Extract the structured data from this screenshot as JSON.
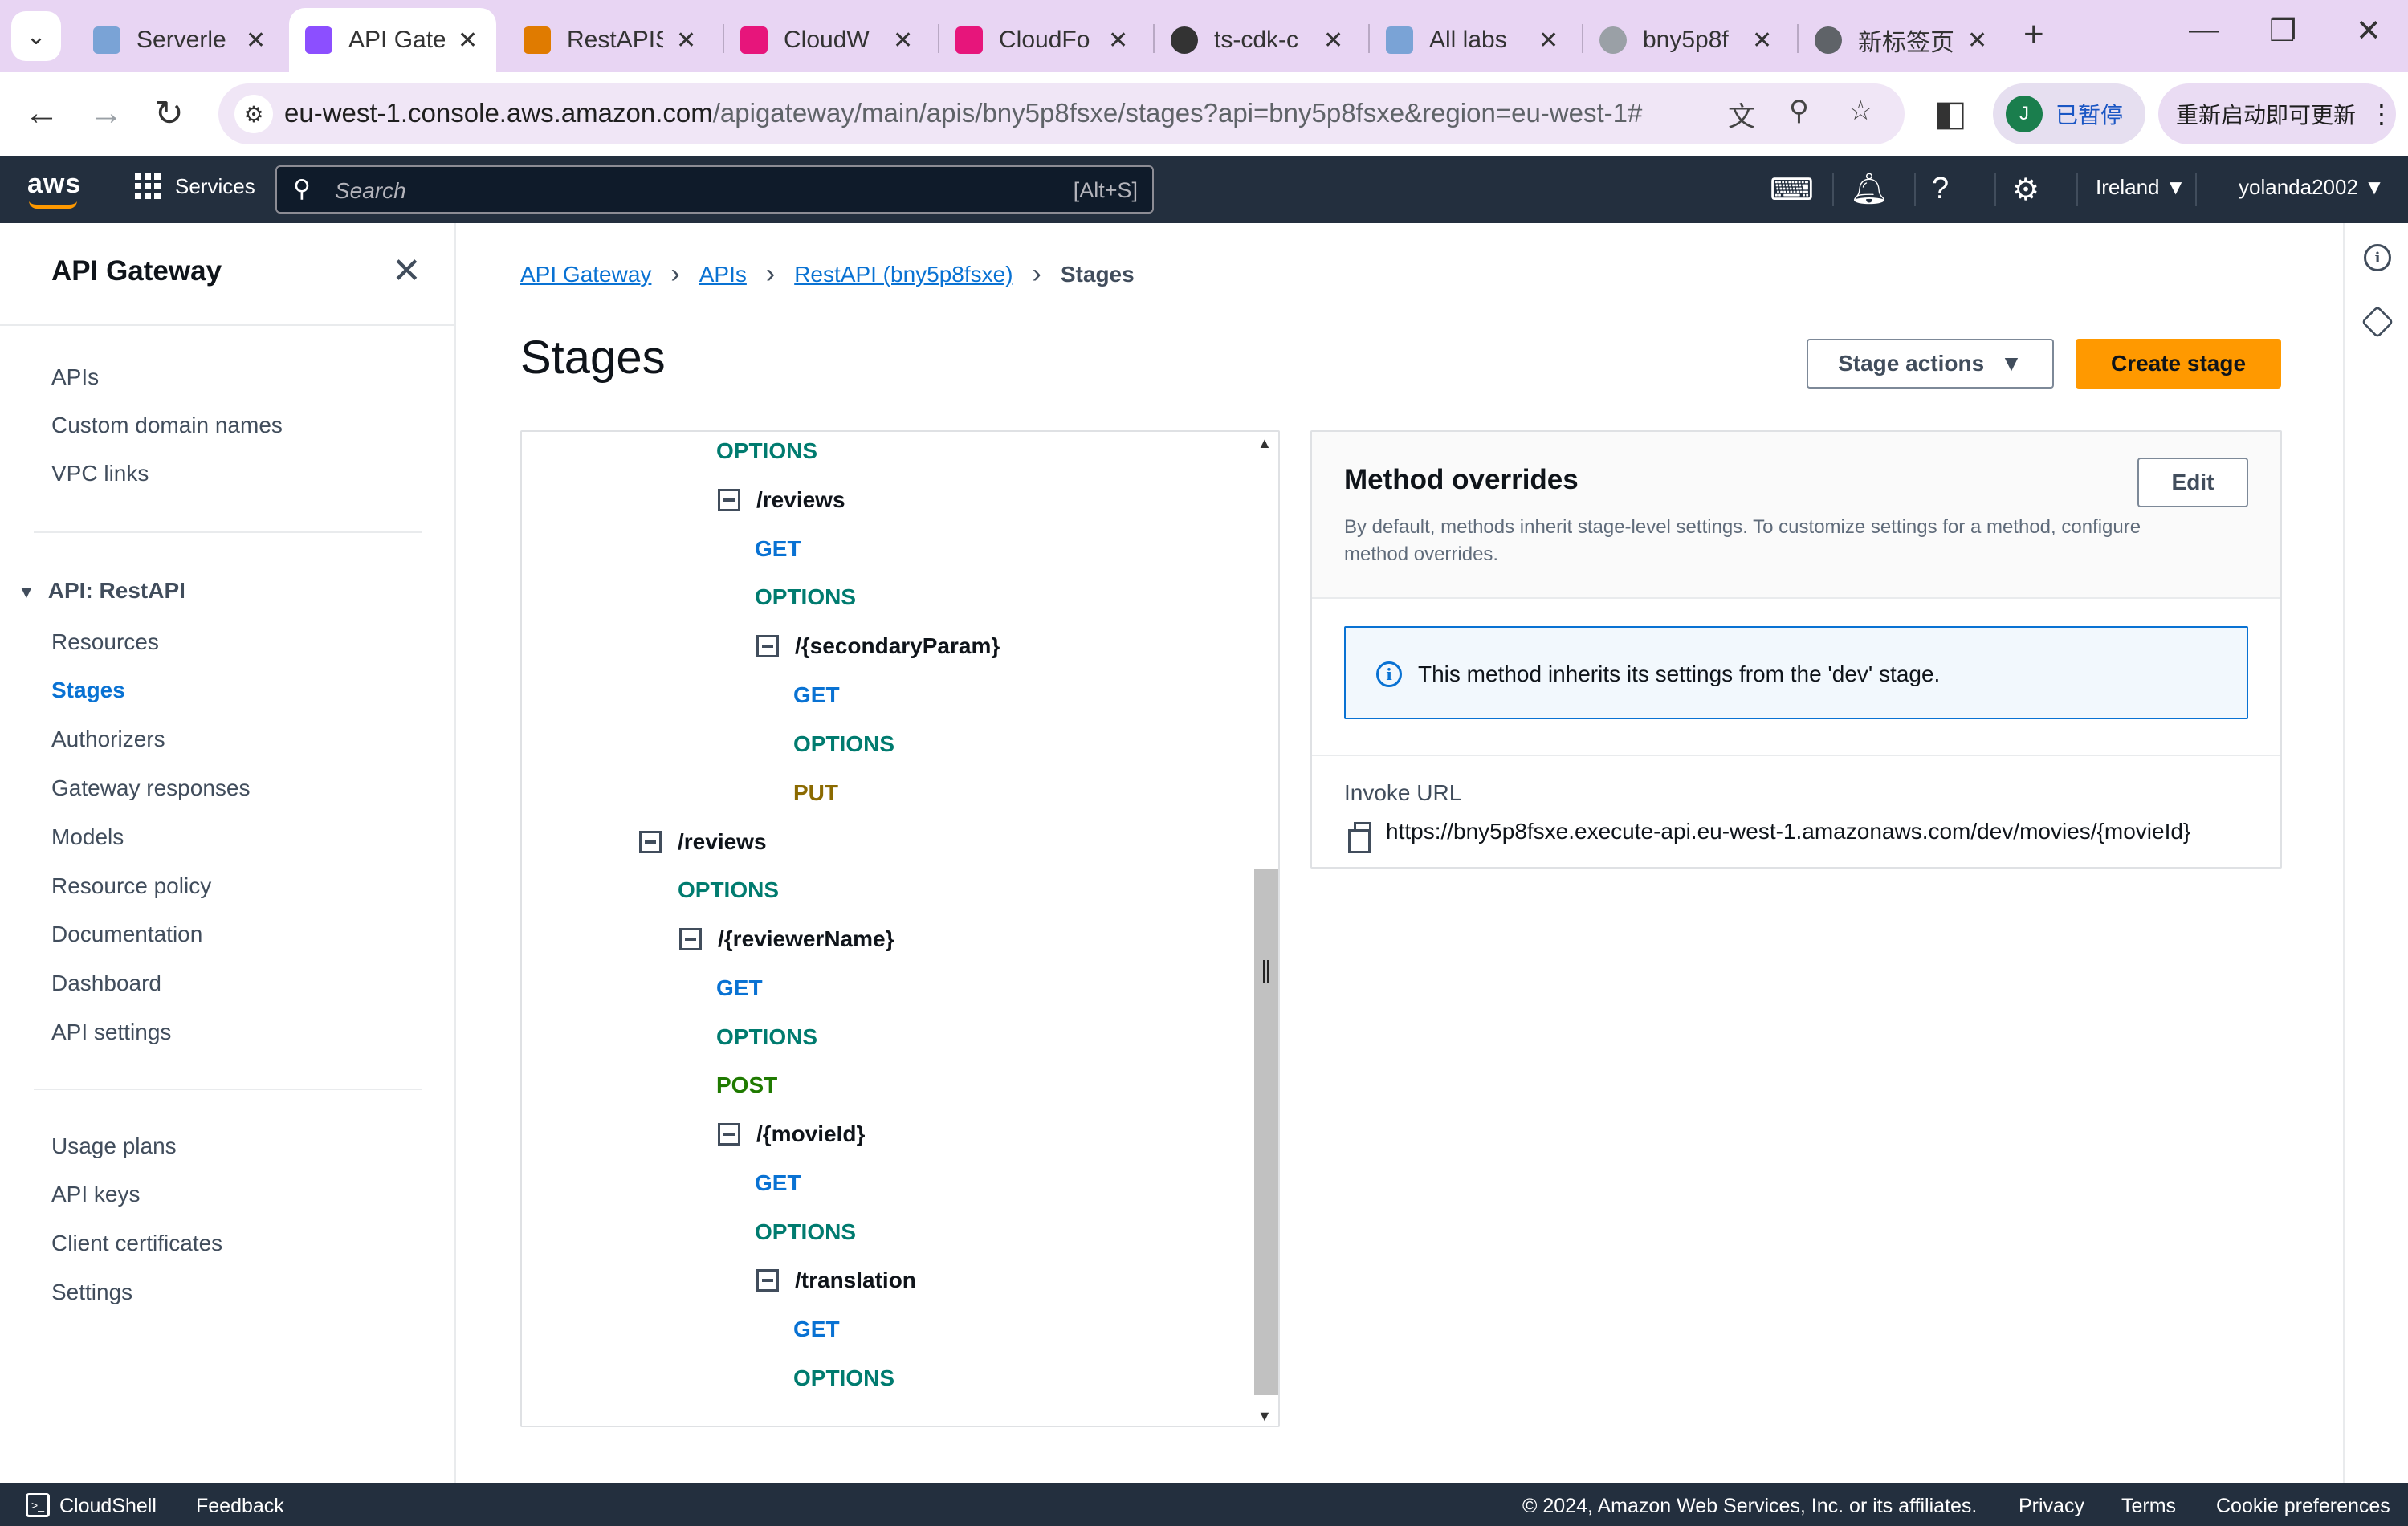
{
  "browser": {
    "tabs": [
      {
        "title": "Serverle",
        "color": "#7aa3d6"
      },
      {
        "title": "API Gate",
        "color": "#8c4fff",
        "active": true
      },
      {
        "title": "RestAPIS",
        "color": "#e07b00"
      },
      {
        "title": "CloudW",
        "color": "#e7157b"
      },
      {
        "title": "CloudFo",
        "color": "#e7157b"
      },
      {
        "title": "ts-cdk-c",
        "color": "#333333"
      },
      {
        "title": "All labs",
        "color": "#7aa3d6"
      },
      {
        "title": "bny5p8f",
        "color": "#9aa0a6"
      },
      {
        "title": "新标签页",
        "color": "#5f6368"
      }
    ],
    "url_host": "eu-west-1.console.aws.amazon.com",
    "url_path": "/apigateway/main/apis/bny5p8fsxe/stages?api=bny5p8fsxe&region=eu-west-1#",
    "profile_initial": "J",
    "profile_status": "已暂停",
    "restart_label": "重新启动即可更新"
  },
  "topnav": {
    "logo": "aws",
    "services_label": "Services",
    "search_placeholder": "Search",
    "search_shortcut": "[Alt+S]",
    "region": "Ireland",
    "user": "yolanda2002"
  },
  "sidenav": {
    "title": "API Gateway",
    "top_items": [
      "APIs",
      "Custom domain names",
      "VPC links"
    ],
    "group_label": "API: RestAPI",
    "group_items": [
      "Resources",
      "Stages",
      "Authorizers",
      "Gateway responses",
      "Models",
      "Resource policy",
      "Documentation",
      "Dashboard",
      "API settings"
    ],
    "active_item": "Stages",
    "bottom_items": [
      "Usage plans",
      "API keys",
      "Client certificates",
      "Settings"
    ]
  },
  "breadcrumb": [
    "API Gateway",
    "APIs",
    "RestAPI (bny5p8fsxe)",
    "Stages"
  ],
  "page_title": "Stages",
  "buttons": {
    "stage_actions": "Stage actions",
    "create_stage": "Create stage",
    "edit": "Edit"
  },
  "tree": [
    {
      "label": "OPTIONS",
      "kind": "method"
    },
    {
      "label": "/reviews",
      "kind": "path"
    },
    {
      "label": "GET",
      "kind": "method"
    },
    {
      "label": "OPTIONS",
      "kind": "method"
    },
    {
      "label": "/{secondaryParam}",
      "kind": "path"
    },
    {
      "label": "GET",
      "kind": "method"
    },
    {
      "label": "OPTIONS",
      "kind": "method"
    },
    {
      "label": "PUT",
      "kind": "method"
    },
    {
      "label": "/reviews",
      "kind": "path"
    },
    {
      "label": "OPTIONS",
      "kind": "method"
    },
    {
      "label": "/{reviewerName}",
      "kind": "path"
    },
    {
      "label": "GET",
      "kind": "method"
    },
    {
      "label": "OPTIONS",
      "kind": "method"
    },
    {
      "label": "POST",
      "kind": "method"
    },
    {
      "label": "/{movieId}",
      "kind": "path"
    },
    {
      "label": "GET",
      "kind": "method"
    },
    {
      "label": "OPTIONS",
      "kind": "method"
    },
    {
      "label": "/translation",
      "kind": "path"
    },
    {
      "label": "GET",
      "kind": "method"
    },
    {
      "label": "OPTIONS",
      "kind": "method"
    }
  ],
  "method_overrides": {
    "title": "Method overrides",
    "description": "By default, methods inherit stage-level settings. To customize settings for a method, configure method overrides.",
    "info": "This method inherits its settings from the 'dev' stage.",
    "invoke_url_label": "Invoke URL",
    "invoke_url": "https://bny5p8fsxe.execute-api.eu-west-1.amazonaws.com/dev/movies/{movieId}"
  },
  "footer": {
    "cloudshell": "CloudShell",
    "feedback": "Feedback",
    "copyright": "© 2024, Amazon Web Services, Inc. or its affiliates.",
    "privacy": "Privacy",
    "terms": "Terms",
    "cookie": "Cookie preferences"
  },
  "colors": {
    "accent": "#ff9900",
    "link": "#0972d3",
    "nav_bg": "#232f3e",
    "method_get": "#0972d3",
    "method_options": "#007b6f",
    "method_put": "#8b6a00",
    "method_post": "#1f7a00"
  }
}
